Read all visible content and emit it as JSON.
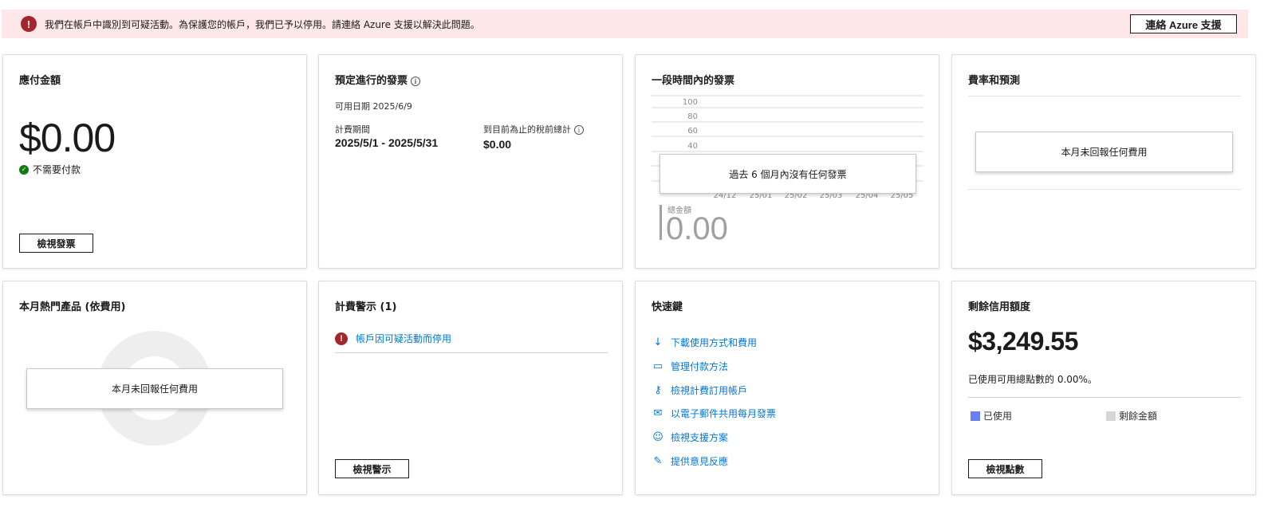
{
  "banner": {
    "message": "我們在帳戶中識別到可疑活動。為保護您的帳戶，我們已予以停用。請連絡 Azure 支援以解決此問題。",
    "button_label": "連絡 Azure 支援",
    "icon": "error-icon",
    "icon_glyph": "!"
  },
  "amount_due": {
    "title": "應付金額",
    "amount": "$0.00",
    "status": "不需要付款",
    "button_label": "檢視發票"
  },
  "upcoming_invoice": {
    "title": "預定進行的發票",
    "available_date": "可用日期 2025/6/9",
    "period_label": "計費期間",
    "period_value": "2025/5/1 - 2025/5/31",
    "pretax_label": "到目前為止的稅前總計",
    "pretax_value": "$0.00",
    "info_glyph": "i"
  },
  "invoices_over_time": {
    "title": "一段時間內的發票",
    "y_ticks": [
      "100",
      "80",
      "60",
      "40"
    ],
    "x_ticks": [
      "24/12",
      "25/01",
      "25/02",
      "25/03",
      "25/04",
      "25/05"
    ],
    "empty_message": "過去 6 個月內沒有任何發票",
    "total_label": "總金額",
    "total_value": "0.00"
  },
  "rates_forecast": {
    "title": "費率和預測",
    "empty_message": "本月未回報任何費用"
  },
  "top_products": {
    "title": "本月熱門產品 (依費用)",
    "empty_message": "本月未回報任何費用"
  },
  "billing_alerts": {
    "title": "計費警示 (1)",
    "alert_text": "帳戶因可疑活動而停用",
    "button_label": "檢視警示"
  },
  "shortcuts": {
    "title": "快速鍵",
    "items": [
      {
        "label": "下載使用方式和費用",
        "icon": "download-icon",
        "glyph": "↓"
      },
      {
        "label": "管理付款方法",
        "icon": "credit-card-icon",
        "glyph": "▭"
      },
      {
        "label": "檢視計費訂用帳戶",
        "icon": "key-icon",
        "glyph": "⚷"
      },
      {
        "label": "以電子郵件共用每月發票",
        "icon": "mail-icon",
        "glyph": "✉"
      },
      {
        "label": "檢視支援方案",
        "icon": "support-icon",
        "glyph": "☺"
      },
      {
        "label": "提供意見反應",
        "icon": "feedback-icon",
        "glyph": "✎"
      }
    ]
  },
  "remaining_credit": {
    "title": "剩餘信用額度",
    "amount": "$3,249.55",
    "used_text": "已使用可用總點數的 0.00%。",
    "legend_used": "已使用",
    "legend_remaining": "剩餘金額",
    "used_color": "#6a7ff5",
    "remaining_color": "#d6d6d6",
    "button_label": "檢視點數"
  },
  "colors": {
    "error": "#a4262c",
    "banner_bg": "#fde7e9",
    "link": "#0078d4",
    "success": "#107c10"
  }
}
